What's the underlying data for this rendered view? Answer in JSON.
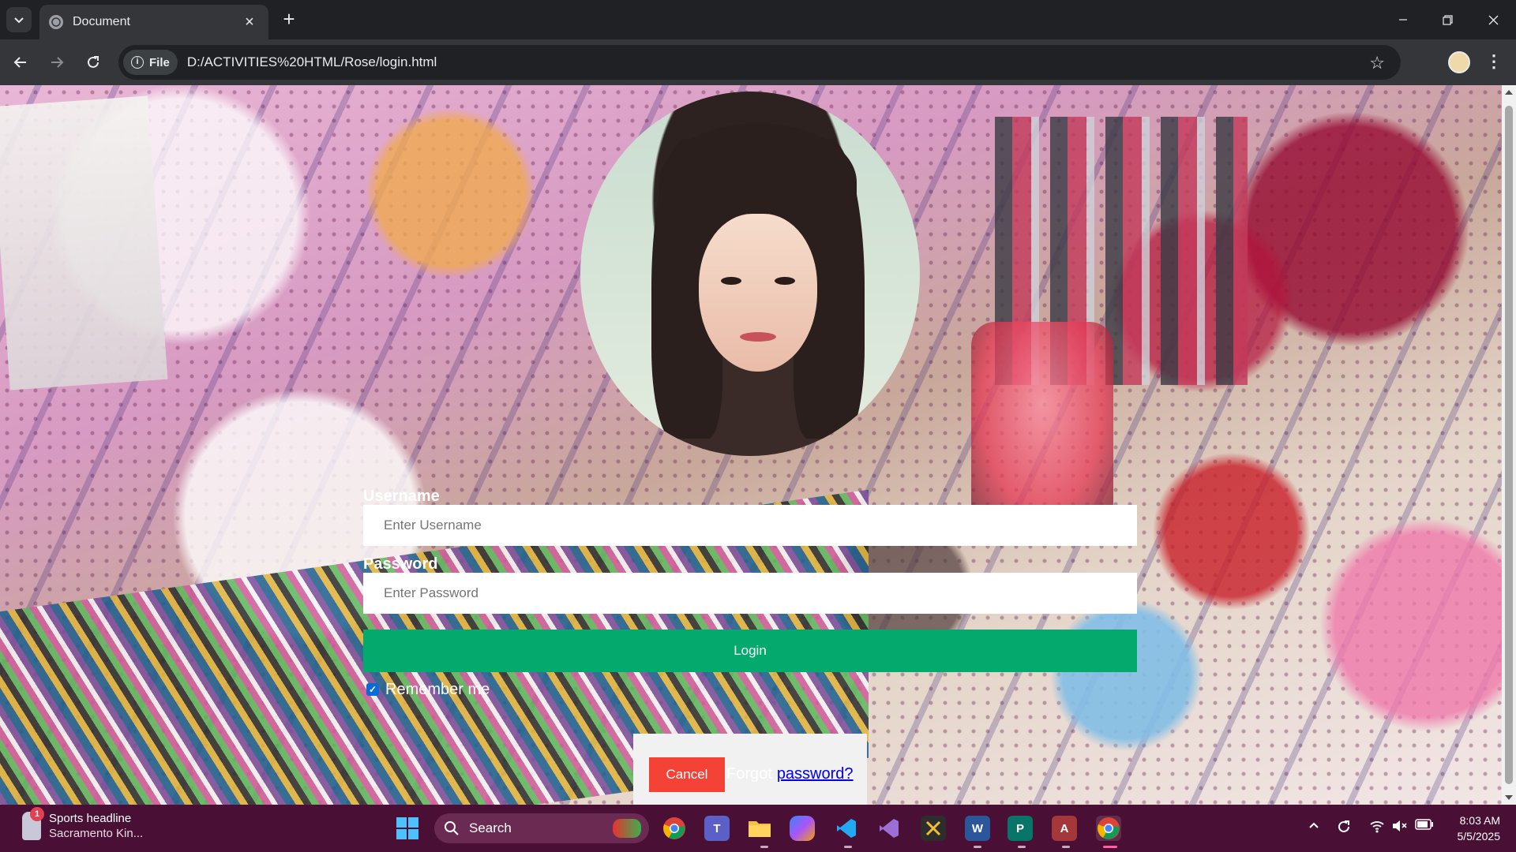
{
  "browser": {
    "tab_title": "Document",
    "new_tab_label": "+",
    "file_chip": "File",
    "url": "D:/ACTIVITIES%20HTML/Rose/login.html"
  },
  "form": {
    "username_label": "Username",
    "username_placeholder": "Enter Username",
    "password_label": "Password",
    "password_placeholder": "Enter Password",
    "login_label": "Login",
    "remember_label": "Remember me",
    "remember_checked": true
  },
  "footer": {
    "cancel_label": "Cancel",
    "forgot_text": "Forgot",
    "password_link": "password?"
  },
  "taskbar": {
    "news_badge": "1",
    "news_title": "Sports headline",
    "news_subtitle": "Sacramento Kin...",
    "search_label": "Search",
    "time": "8:03 AM",
    "date": "5/5/2025",
    "apps": [
      "chrome-icon",
      "teams-icon",
      "file-explorer-icon",
      "copilot-icon",
      "vscode-icon",
      "visual-studio-icon",
      "snipping-tool-icon",
      "word-icon",
      "publisher-icon",
      "access-icon",
      "chrome-active-icon"
    ]
  },
  "colors": {
    "login_button": "#04aa6d",
    "cancel_button": "#f44336",
    "taskbar": "#4a0f35",
    "link": "#0000ee"
  }
}
